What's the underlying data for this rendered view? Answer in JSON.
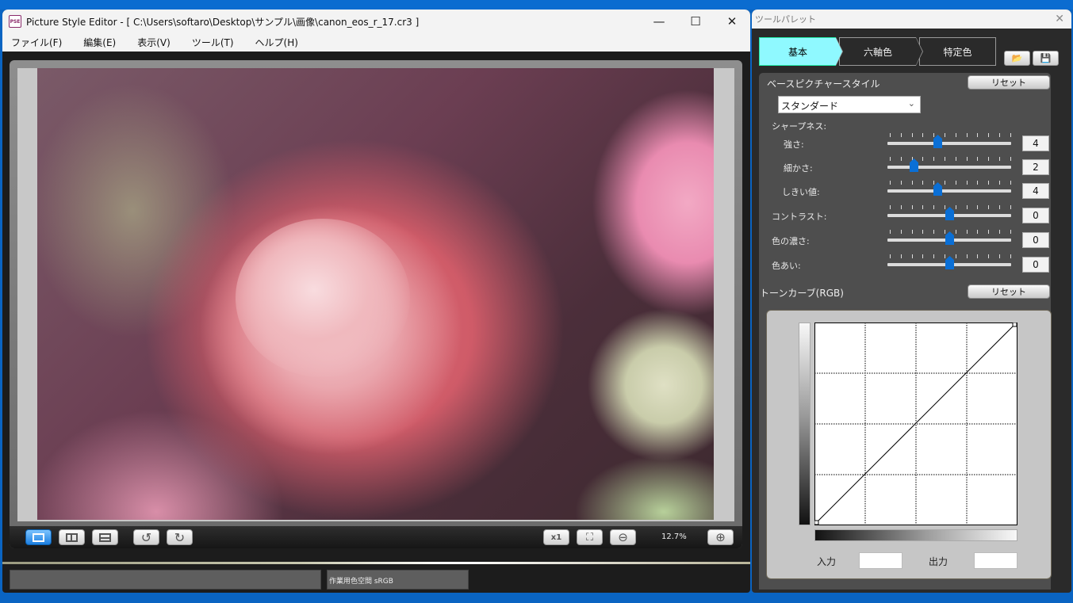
{
  "main_window": {
    "title": "Picture Style Editor - [ C:\\Users\\softaro\\Desktop\\サンプル\\画像\\canon_eos_r_17.cr3 ]",
    "app_icon_text": "PSE",
    "controls": {
      "minimize": "—",
      "maximize": "☐",
      "close": "✕"
    },
    "menu": [
      {
        "label": "ファイル(F)"
      },
      {
        "label": "編集(E)"
      },
      {
        "label": "表示(V)"
      },
      {
        "label": "ツール(T)"
      },
      {
        "label": "ヘルプ(H)"
      }
    ],
    "viewer_toolbar": {
      "view_modes": [
        {
          "icon": "single-view-icon",
          "active": true
        },
        {
          "icon": "split-vertical-icon",
          "active": false
        },
        {
          "icon": "split-horizontal-icon",
          "active": false
        }
      ],
      "rotate_left": "↺",
      "rotate_right": "↻",
      "actual_size": "x1",
      "fit": "⛶",
      "zoom_out": "⊖",
      "zoom_level": "12.7%",
      "zoom_in": "⊕"
    },
    "status": {
      "left": "",
      "color_space": "作業用色空間  sRGB"
    }
  },
  "palette": {
    "title": "ツールパレット",
    "close": "✕",
    "tabs": [
      {
        "label": "基本",
        "active": true
      },
      {
        "label": "六軸色",
        "active": false
      },
      {
        "label": "特定色",
        "active": false
      }
    ],
    "open_icon": "📂",
    "save_icon": "💾",
    "base_style": {
      "label": "ベースピクチャースタイル",
      "reset": "リセット",
      "selected": "スタンダード",
      "chevron": "⌄"
    },
    "sharpness_label": "シャープネス:",
    "sliders": [
      {
        "label": "強さ:",
        "value": "4",
        "min": 0,
        "max": 10,
        "pos": 4
      },
      {
        "label": "細かさ:",
        "value": "2",
        "min": 1,
        "max": 5,
        "pos": 2
      },
      {
        "label": "しきい値:",
        "value": "4",
        "min": 1,
        "max": 5,
        "pos": 4
      },
      {
        "label": "コントラスト:",
        "value": "0",
        "min": -4,
        "max": 4,
        "pos": 0
      },
      {
        "label": "色の濃さ:",
        "value": "0",
        "min": -4,
        "max": 4,
        "pos": 0
      },
      {
        "label": "色あい:",
        "value": "0",
        "min": -4,
        "max": 4,
        "pos": 0
      }
    ],
    "tone_curve": {
      "label": "トーンカーブ(RGB)",
      "reset": "リセット",
      "input_label": "入力",
      "output_label": "出力",
      "input_value": "",
      "output_value": "",
      "points": [
        [
          0,
          0
        ],
        [
          255,
          255
        ]
      ]
    }
  }
}
